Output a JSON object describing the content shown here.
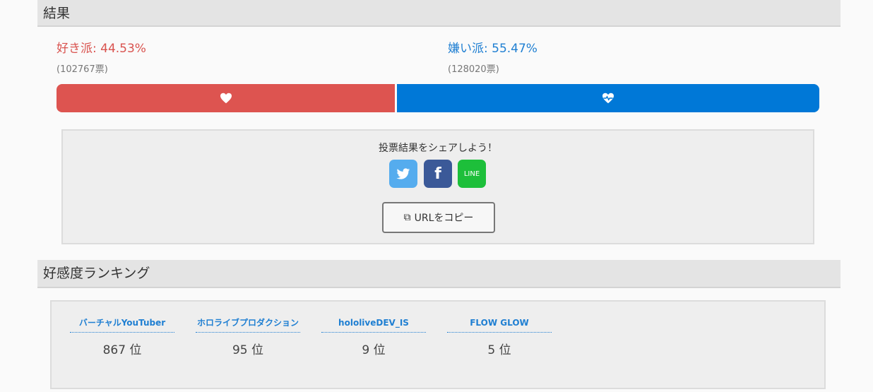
{
  "result": {
    "header": "結果",
    "like": {
      "label": "好き派:",
      "percent": "44.53%",
      "votes": "(102767票)"
    },
    "dislike": {
      "label": "嫌い派:",
      "percent": "55.47%",
      "votes": "(128020票)"
    },
    "like_share": 0.4453,
    "colors": {
      "like": "#dd5450",
      "dislike": "#0078d7"
    }
  },
  "share": {
    "title": "投票結果をシェアしよう！",
    "twitter_icon": "twitter-icon",
    "facebook_glyph": "f",
    "line_label": "LINE",
    "copy_label": "URLをコピー"
  },
  "ranking": {
    "header": "好感度ランキング",
    "items": [
      {
        "name": "バーチャルYouTuber",
        "rank": "867 位"
      },
      {
        "name": "ホロライブプロダクション",
        "rank": "95 位"
      },
      {
        "name": "hololiveDEV_IS",
        "rank": "9 位"
      },
      {
        "name": "FLOW GLOW",
        "rank": "5 位"
      }
    ]
  }
}
